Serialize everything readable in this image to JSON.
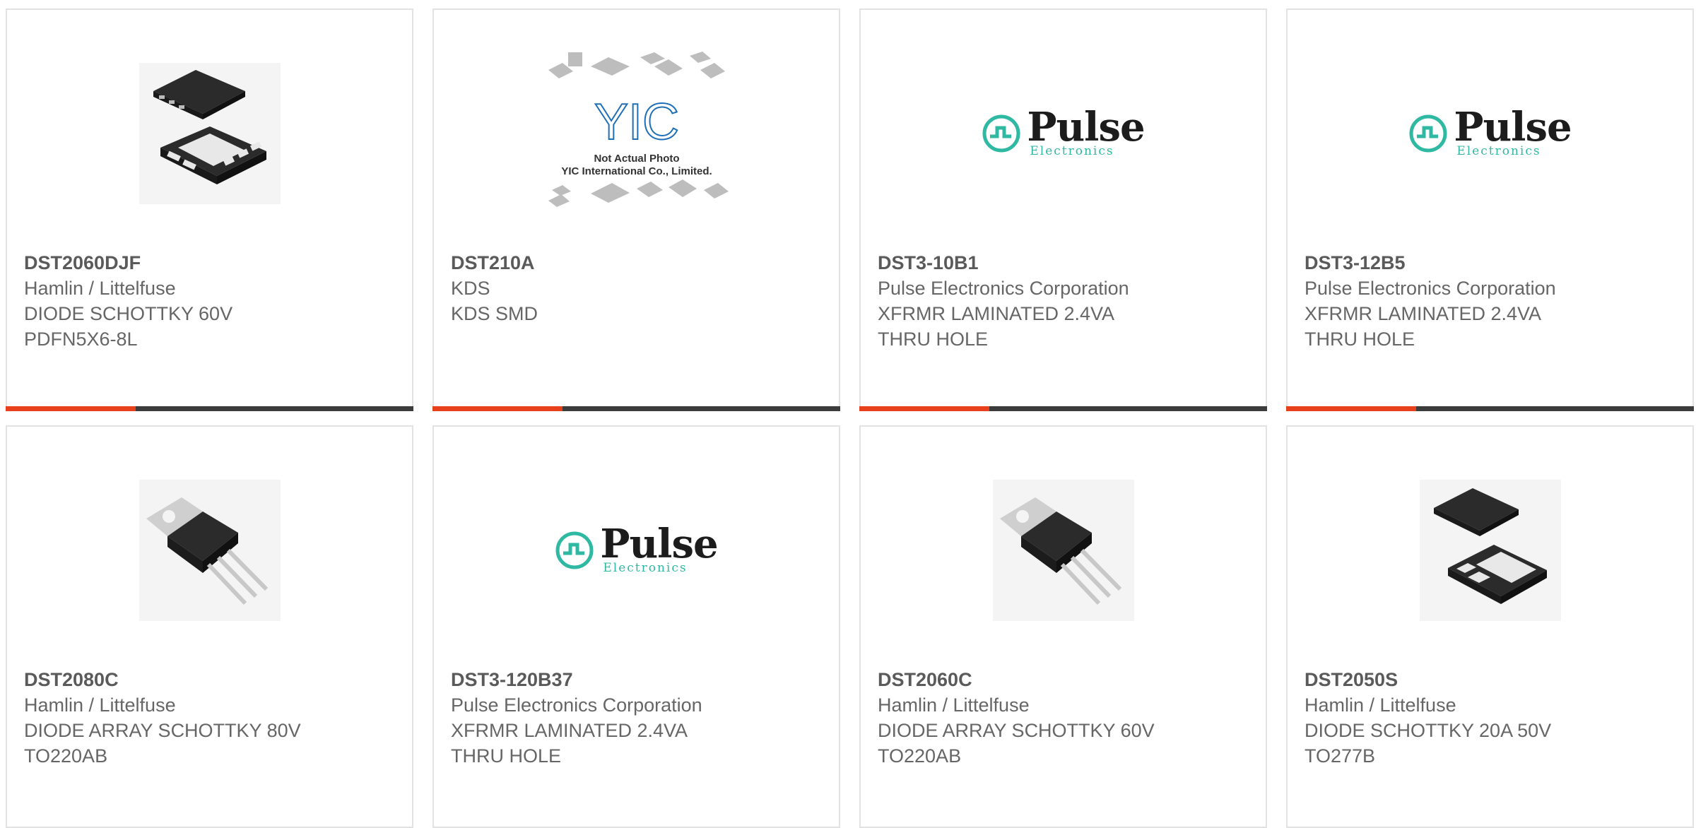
{
  "products": [
    {
      "part": "DST2060DJF",
      "manufacturer": "Hamlin / Littelfuse",
      "desc1": "DIODE SCHOTTKY 60V",
      "desc2": "PDFN5X6-8L",
      "image": "pdfn-package-icon"
    },
    {
      "part": "DST210A",
      "manufacturer": "KDS",
      "desc1": "KDS SMD",
      "desc2": "",
      "image": "yic-placeholder-image",
      "yic_caption1": "Not Actual Photo",
      "yic_caption2": "YIC International Co., Limited."
    },
    {
      "part": "DST3-10B1",
      "manufacturer": "Pulse Electronics Corporation",
      "desc1": "XFRMR LAMINATED 2.4VA",
      "desc2": "THRU HOLE",
      "image": "pulse-logo"
    },
    {
      "part": "DST3-12B5",
      "manufacturer": "Pulse Electronics Corporation",
      "desc1": "XFRMR LAMINATED 2.4VA",
      "desc2": "THRU HOLE",
      "image": "pulse-logo"
    },
    {
      "part": "DST2080C",
      "manufacturer": "Hamlin / Littelfuse",
      "desc1": "DIODE ARRAY SCHOTTKY 80V",
      "desc2": "TO220AB",
      "image": "to220-package-icon"
    },
    {
      "part": "DST3-120B37",
      "manufacturer": "Pulse Electronics Corporation",
      "desc1": "XFRMR LAMINATED 2.4VA",
      "desc2": "THRU HOLE",
      "image": "pulse-logo"
    },
    {
      "part": "DST2060C",
      "manufacturer": "Hamlin / Littelfuse",
      "desc1": "DIODE ARRAY SCHOTTKY 60V",
      "desc2": "TO220AB",
      "image": "to220-package-icon"
    },
    {
      "part": "DST2050S",
      "manufacturer": "Hamlin / Littelfuse",
      "desc1": "DIODE SCHOTTKY 20A 50V",
      "desc2": "TO277B",
      "image": "to277-package-icon"
    }
  ],
  "logo": {
    "pulse_main": "Pulse",
    "pulse_sub": "Electronics",
    "yic_letters": "YIC"
  },
  "colors": {
    "accent": "#e8401c",
    "bar": "#3c3c3c",
    "pulse_teal": "#2fb9a2",
    "text": "#666666"
  }
}
